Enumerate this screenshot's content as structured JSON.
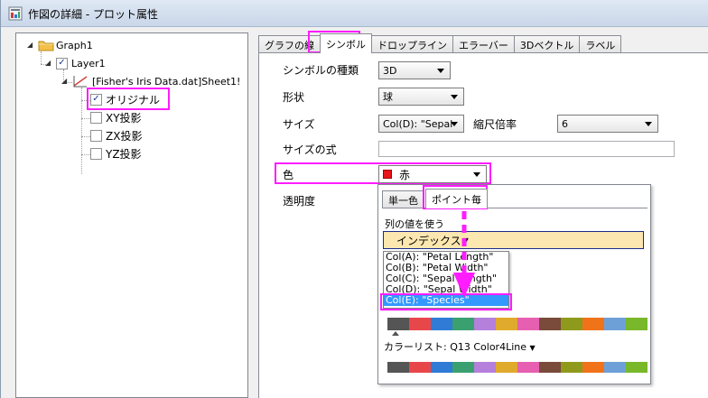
{
  "window": {
    "title": "作図の詳細 - プロット属性"
  },
  "tree": {
    "graph": "Graph1",
    "layer": "Layer1",
    "dataset": "[Fisher's Iris Data.dat]Sheet1!",
    "items": [
      {
        "label": "オリジナル",
        "checked": true
      },
      {
        "label": "XY投影",
        "checked": false
      },
      {
        "label": "ZX投影",
        "checked": false
      },
      {
        "label": "YZ投影",
        "checked": false
      }
    ],
    "checked_mark": "✓"
  },
  "tabs": [
    "グラフの線",
    "シンボル",
    "ドロップライン",
    "エラーバー",
    "3Dベクトル",
    "ラベル"
  ],
  "symbol": {
    "type_label": "シンボルの種類",
    "type_value": "3D",
    "shape_label": "形状",
    "shape_value": "球",
    "size_label": "サイズ",
    "size_value": "Col(D): \"Sepal",
    "scale_label": "縮尺倍率",
    "scale_value": "6",
    "size_formula_label": "サイズの式",
    "size_formula_value": "",
    "color_label": "色",
    "color_value": "赤",
    "color_swatch": "#e8141b",
    "transparency_label": "透明度"
  },
  "popup": {
    "tab_single": "単一色",
    "tab_per_point": "ポイント毎",
    "use_column_label": "列の値を使う",
    "index_value": "インデックス",
    "columns": [
      "Col(A): \"Petal Length\"",
      "Col(B): \"Petal Width\"",
      "Col(C): \"Sepal Length\"",
      "Col(D): \"Sepal Width\"",
      "Col(E): \"Species\""
    ],
    "selected_column": "Col(E): \"Species\"",
    "colorlist_label": "カラーリスト: Q13 Color4Line",
    "colors": [
      "#555555",
      "#e8474a",
      "#2f7bd6",
      "#3aa06f",
      "#b57fdc",
      "#e0aa2d",
      "#e65fb0",
      "#7a4a3a",
      "#8f9a1c",
      "#f0731a",
      "#6ea0d8",
      "#78b82a"
    ],
    "highlight_color": "#ff1cff",
    "selection_bg": "#3399ff"
  }
}
